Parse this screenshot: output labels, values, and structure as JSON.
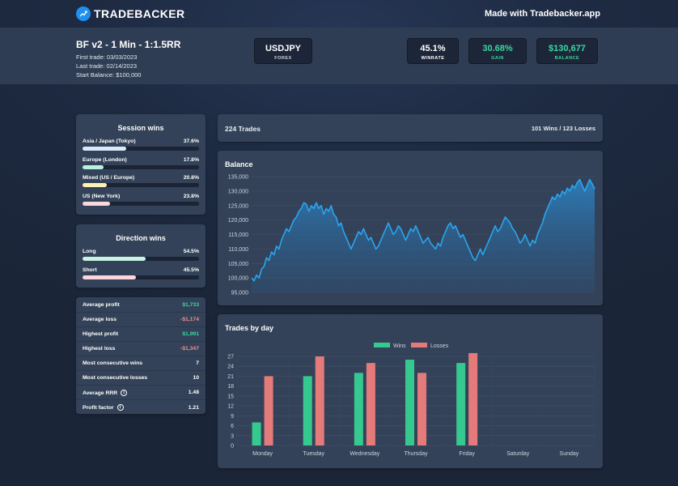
{
  "brand": {
    "name": "TRADEBACKER",
    "made_with": "Made with Tradebacker.app"
  },
  "strategy": {
    "title": "BF v2 - 1 Min - 1:1.5RR",
    "first_trade": "First trade: 03/03/2023",
    "last_trade": "Last trade: 02/14/2023",
    "start_balance": "Start Balance: $100,000"
  },
  "instrument": {
    "symbol": "USDJPY",
    "type": "FOREX"
  },
  "kpis": [
    {
      "value": "45.1%",
      "label": "WINRATE",
      "color": "#ffffff"
    },
    {
      "value": "30.68%",
      "label": "GAIN",
      "color": "#38d9a0"
    },
    {
      "value": "$130,677",
      "label": "BALANCE",
      "color": "#38d9a0"
    }
  ],
  "session_wins": {
    "title": "Session wins",
    "items": [
      {
        "label": "Asia / Japan (Tokyo)",
        "value": "37.6%",
        "fraction": 0.376,
        "color": "#dbe9fb"
      },
      {
        "label": "Europe (London)",
        "value": "17.8%",
        "fraction": 0.178,
        "color": "#b8f1e0"
      },
      {
        "label": "Mixed (US / Europe)",
        "value": "20.8%",
        "fraction": 0.208,
        "color": "#faf3b3"
      },
      {
        "label": "US (New York)",
        "value": "23.8%",
        "fraction": 0.238,
        "color": "#fbd6dc"
      }
    ]
  },
  "direction_wins": {
    "title": "Direction wins",
    "items": [
      {
        "label": "Long",
        "value": "54.5%",
        "fraction": 0.545,
        "color": "#c8f4e6"
      },
      {
        "label": "Short",
        "value": "45.5%",
        "fraction": 0.455,
        "color": "#fbd6dc"
      }
    ]
  },
  "stats": [
    {
      "label": "Average profit",
      "value": "$1,733",
      "tone": "green",
      "info": false
    },
    {
      "label": "Average loss",
      "value": "-$1,174",
      "tone": "red",
      "info": false
    },
    {
      "label": "Highest profit",
      "value": "$1,991",
      "tone": "green",
      "info": false
    },
    {
      "label": "Highest loss",
      "value": "-$1,347",
      "tone": "red",
      "info": false
    },
    {
      "label": "Most consecutive wins",
      "value": "7",
      "tone": "white",
      "info": false
    },
    {
      "label": "Most consecutive losses",
      "value": "10",
      "tone": "white",
      "info": false
    },
    {
      "label": "Average RRR",
      "value": "1.48",
      "tone": "white",
      "info": true
    },
    {
      "label": "Profit factor",
      "value": "1.21",
      "tone": "white",
      "info": true
    }
  ],
  "summary": {
    "trades": "224 Trades",
    "wins_losses": "101 Wins / 123 Losses"
  },
  "balance_chart": {
    "title": "Balance",
    "chart_data": {
      "type": "area",
      "title": "Balance",
      "ylim": [
        95000,
        135000
      ],
      "y_ticks": [
        "95,000",
        "100,000",
        "105,000",
        "110,000",
        "115,000",
        "120,000",
        "125,000",
        "130,000",
        "135,000"
      ],
      "y_tick_values": [
        95000,
        100000,
        105000,
        110000,
        115000,
        120000,
        125000,
        130000,
        135000
      ],
      "line_color": "#2aa5f0",
      "grid": true,
      "values": [
        100000,
        99000,
        101000,
        100000,
        103000,
        104000,
        107000,
        106000,
        109000,
        108000,
        111000,
        110000,
        113000,
        115000,
        117000,
        116000,
        118000,
        120000,
        121000,
        123000,
        124000,
        126000,
        125500,
        123000,
        125000,
        124000,
        126000,
        124000,
        125000,
        122000,
        124000,
        123000,
        125000,
        122000,
        121000,
        118000,
        119000,
        116000,
        114000,
        112000,
        110000,
        112000,
        114000,
        116000,
        115000,
        117000,
        115000,
        113000,
        114000,
        112000,
        110000,
        111000,
        113000,
        115000,
        117000,
        119000,
        117000,
        115000,
        116000,
        118000,
        117000,
        115000,
        113000,
        115000,
        117000,
        116000,
        118000,
        116000,
        114000,
        112000,
        113000,
        114000,
        112000,
        111000,
        110000,
        112000,
        111000,
        114000,
        116000,
        118000,
        119000,
        117000,
        118000,
        116000,
        114000,
        115000,
        113000,
        111000,
        109000,
        107000,
        106000,
        108000,
        110000,
        108000,
        110000,
        112000,
        114000,
        116000,
        118000,
        116000,
        117000,
        119000,
        121000,
        120000,
        119000,
        117000,
        116000,
        114000,
        112000,
        113000,
        115000,
        113000,
        111000,
        113000,
        112000,
        115000,
        117000,
        119000,
        122000,
        124000,
        126000,
        128000,
        127000,
        129000,
        128000,
        130000,
        129000,
        131000,
        130000,
        132000,
        131000,
        133000,
        134000,
        132000,
        130000,
        132000,
        134000,
        132500,
        130700
      ]
    }
  },
  "trades_by_day": {
    "title": "Trades by day",
    "chart_data": {
      "type": "bar",
      "categories": [
        "Monday",
        "Tuesday",
        "Wednesday",
        "Thursday",
        "Friday",
        "Saturday",
        "Sunday"
      ],
      "series": [
        {
          "name": "Wins",
          "values": [
            7,
            21,
            22,
            26,
            25,
            0,
            0
          ],
          "color": "#35c98f"
        },
        {
          "name": "Losses",
          "values": [
            21,
            27,
            25,
            22,
            28,
            0,
            0
          ],
          "color": "#e57a7a"
        }
      ],
      "ylim": [
        0,
        27
      ],
      "y_ticks": [
        "0",
        "3",
        "6",
        "9",
        "12",
        "15",
        "18",
        "21",
        "24",
        "27"
      ],
      "y_tick_values": [
        0,
        3,
        6,
        9,
        12,
        15,
        18,
        21,
        24,
        27
      ],
      "legend_position": "top-center",
      "grid": true
    }
  }
}
